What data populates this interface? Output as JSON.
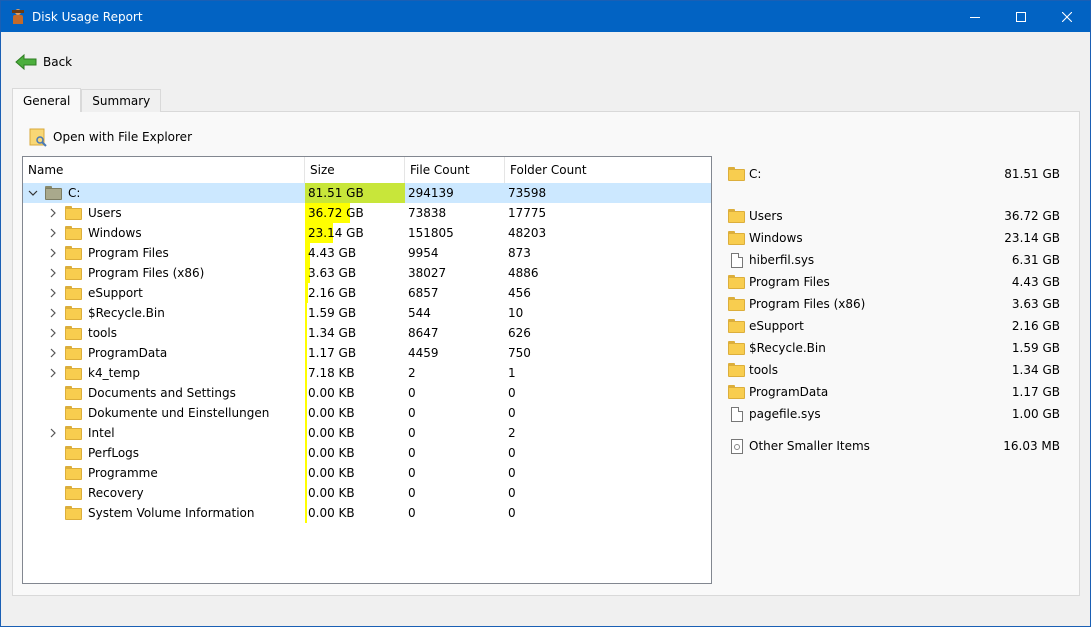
{
  "window": {
    "title": "Disk Usage Report",
    "titlebar_color": "#0263c3"
  },
  "toolbar": {
    "back_label": "Back"
  },
  "tabs": [
    {
      "label": "General",
      "active": true
    },
    {
      "label": "Summary",
      "active": false
    }
  ],
  "actions": {
    "open_explorer_label": "Open with File Explorer"
  },
  "tree": {
    "columns": {
      "name": "Name",
      "size": "Size",
      "file_count": "File Count",
      "folder_count": "Folder Count"
    },
    "rows": [
      {
        "name": "C:",
        "size": "81.51 GB",
        "files": "294139",
        "folders": "73598",
        "level": 0,
        "expander": "expanded",
        "icon": "drive-folder-icon",
        "fraction": 1.0,
        "selected": true
      },
      {
        "name": "Users",
        "size": "36.72 GB",
        "files": "73838",
        "folders": "17775",
        "level": 1,
        "expander": "collapsed",
        "icon": "folder-icon",
        "fraction": 0.45
      },
      {
        "name": "Windows",
        "size": "23.14 GB",
        "files": "151805",
        "folders": "48203",
        "level": 1,
        "expander": "collapsed",
        "icon": "folder-icon",
        "fraction": 0.284
      },
      {
        "name": "Program Files",
        "size": "4.43 GB",
        "files": "9954",
        "folders": "873",
        "level": 1,
        "expander": "collapsed",
        "icon": "folder-icon",
        "fraction": 0.054
      },
      {
        "name": "Program Files (x86)",
        "size": "3.63 GB",
        "files": "38027",
        "folders": "4886",
        "level": 1,
        "expander": "collapsed",
        "icon": "folder-icon",
        "fraction": 0.045
      },
      {
        "name": "eSupport",
        "size": "2.16 GB",
        "files": "6857",
        "folders": "456",
        "level": 1,
        "expander": "collapsed",
        "icon": "folder-icon",
        "fraction": 0.026
      },
      {
        "name": "$Recycle.Bin",
        "size": "1.59 GB",
        "files": "544",
        "folders": "10",
        "level": 1,
        "expander": "collapsed",
        "icon": "folder-icon",
        "fraction": 0.02
      },
      {
        "name": "tools",
        "size": "1.34 GB",
        "files": "8647",
        "folders": "626",
        "level": 1,
        "expander": "collapsed",
        "icon": "folder-icon",
        "fraction": 0.016
      },
      {
        "name": "ProgramData",
        "size": "1.17 GB",
        "files": "4459",
        "folders": "750",
        "level": 1,
        "expander": "collapsed",
        "icon": "folder-icon",
        "fraction": 0.014
      },
      {
        "name": "k4_temp",
        "size": "7.18 KB",
        "files": "2",
        "folders": "1",
        "level": 1,
        "expander": "collapsed",
        "icon": "folder-icon",
        "fraction": 0.01
      },
      {
        "name": "Documents and Settings",
        "size": "0.00 KB",
        "files": "0",
        "folders": "0",
        "level": 1,
        "expander": "none",
        "icon": "folder-icon",
        "fraction": 0.01
      },
      {
        "name": "Dokumente und Einstellungen",
        "size": "0.00 KB",
        "files": "0",
        "folders": "0",
        "level": 1,
        "expander": "none",
        "icon": "folder-icon",
        "fraction": 0.01
      },
      {
        "name": "Intel",
        "size": "0.00 KB",
        "files": "0",
        "folders": "2",
        "level": 1,
        "expander": "collapsed",
        "icon": "folder-icon",
        "fraction": 0.01
      },
      {
        "name": "PerfLogs",
        "size": "0.00 KB",
        "files": "0",
        "folders": "0",
        "level": 1,
        "expander": "none",
        "icon": "folder-icon",
        "fraction": 0.01
      },
      {
        "name": "Programme",
        "size": "0.00 KB",
        "files": "0",
        "folders": "0",
        "level": 1,
        "expander": "none",
        "icon": "folder-icon",
        "fraction": 0.01
      },
      {
        "name": "Recovery",
        "size": "0.00 KB",
        "files": "0",
        "folders": "0",
        "level": 1,
        "expander": "none",
        "icon": "folder-icon",
        "fraction": 0.01
      },
      {
        "name": "System Volume Information",
        "size": "0.00 KB",
        "files": "0",
        "folders": "0",
        "level": 1,
        "expander": "none",
        "icon": "folder-icon",
        "fraction": 0.01
      }
    ],
    "bar_color": "#ffff00",
    "root_bar_color": "#c8e63a"
  },
  "summary_list": {
    "root": {
      "name": "C:",
      "size": "81.51 GB",
      "icon": "folder-icon"
    },
    "items": [
      {
        "name": "Users",
        "size": "36.72 GB",
        "icon": "folder-icon"
      },
      {
        "name": "Windows",
        "size": "23.14 GB",
        "icon": "folder-icon"
      },
      {
        "name": "hiberfil.sys",
        "size": "6.31 GB",
        "icon": "file-icon"
      },
      {
        "name": "Program Files",
        "size": "4.43 GB",
        "icon": "folder-icon"
      },
      {
        "name": "Program Files (x86)",
        "size": "3.63 GB",
        "icon": "folder-icon"
      },
      {
        "name": "eSupport",
        "size": "2.16 GB",
        "icon": "folder-icon"
      },
      {
        "name": "$Recycle.Bin",
        "size": "1.59 GB",
        "icon": "folder-icon"
      },
      {
        "name": "tools",
        "size": "1.34 GB",
        "icon": "folder-icon"
      },
      {
        "name": "ProgramData",
        "size": "1.17 GB",
        "icon": "folder-icon"
      },
      {
        "name": "pagefile.sys",
        "size": "1.00 GB",
        "icon": "file-icon"
      }
    ],
    "other": {
      "name": "Other Smaller Items",
      "size": "16.03 MB",
      "icon": "system-file-icon"
    }
  }
}
